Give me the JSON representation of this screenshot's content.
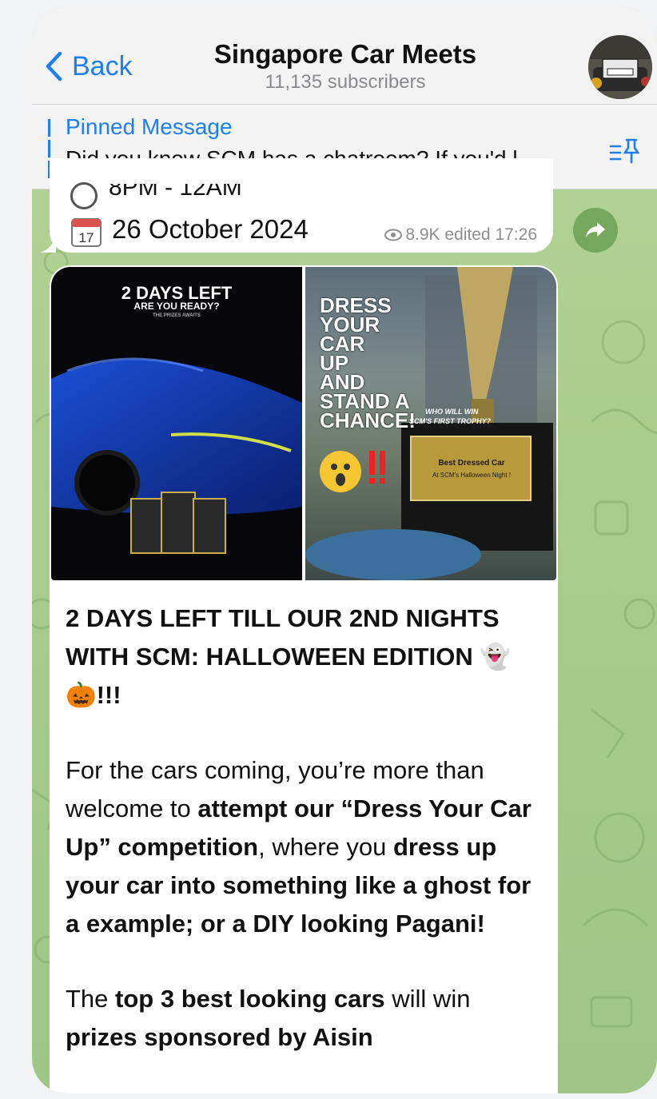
{
  "header": {
    "back_label": "Back",
    "title": "Singapore Car Meets",
    "subtitle": "11,135 subscribers"
  },
  "pinned": {
    "title": "Pinned Message",
    "text": "Did you know SCM has a chatroom? If you'd l..."
  },
  "prev_message": {
    "partial_line": "8PM - 12AM",
    "calendar_day": "17",
    "date": "26 October 2024",
    "views": "8.9K",
    "edited": "edited 17:26"
  },
  "media": {
    "left": {
      "headline": "2 DAYS LEFT",
      "sub": "ARE YOU READY?",
      "tiny": "THE PRIZES AWAITS"
    },
    "right": {
      "line1": "DRESS",
      "line2": "YOUR",
      "line3": "CAR",
      "line4": "UP",
      "line5": "AND",
      "line6": "STAND A",
      "line7": "CHANCE!",
      "who": "WHO WILL WIN",
      "trophy": "SCM'S FIRST TROPHY?",
      "plaque1": "Best Dressed Car",
      "plaque2": "At SCM's Halloween Night !"
    }
  },
  "post": {
    "heading": "2 DAYS LEFT TILL OUR 2ND NIGHTS WITH SCM: HALLOWEEN EDITION 👻🎃!!!",
    "p1_a": "For the cars coming, you’re more than welcome to ",
    "p1_b": "attempt our “Dress Your Car Up” competition",
    "p1_c": ", where you ",
    "p1_d": "dress up your car into something like a ghost for a example; or a DIY looking Pagani!",
    "p2_a": "The ",
    "p2_b": "top 3 best looking cars",
    "p2_c": " will win ",
    "p2_d": "prizes sponsored by Aisin"
  }
}
